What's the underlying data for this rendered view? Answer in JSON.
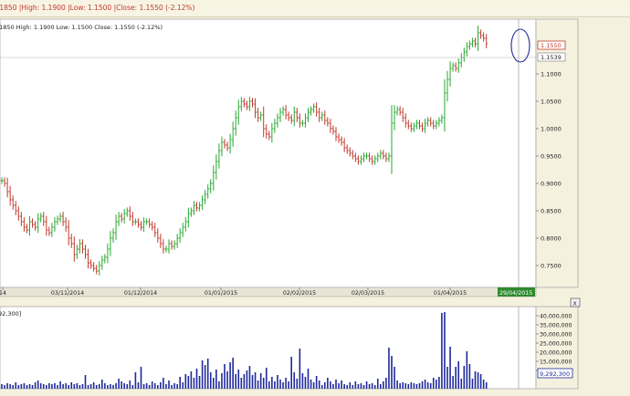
{
  "window": {
    "header_text": ".1850 |High: 1.1900 |Low: 1.1500 |Close: 1.1550 (-2.12%)"
  },
  "price_panel": {
    "legend_text": ".1850   High: 1.1900   Low: 1.1500   Close: 1.1550 (-2.12%)",
    "last_price_label": "1.1550",
    "crosshair_price_label": "1.1539",
    "selected_date_label": "29/04/2015"
  },
  "volume_panel": {
    "legend_text": "92,300]",
    "last_volume_label": "9,292,300",
    "close_label": "x"
  },
  "colors": {
    "up_bar": "#26a92e",
    "down_bar": "#c0392b",
    "volume_bar": "#1f2a9c",
    "last_price_border": "#c0392b",
    "annotation_circle": "#1f2a9c",
    "selected_date_bg": "#2f8a2f"
  },
  "chart_data": {
    "type": "ohlc",
    "ylim": [
      0.71,
      1.2
    ],
    "y_ticks": [
      "1.1000",
      "1.0500",
      "1.0000",
      "0.9500",
      "0.9000",
      "0.8500",
      "0.8000",
      "0.7500"
    ],
    "x_ticks": [
      "14",
      "03/11/2014",
      "01/12/2014",
      "01/01/2015",
      "02/02/2015",
      "02/03/2015",
      "01/04/2015"
    ],
    "closes": [
      0.905,
      0.9,
      0.885,
      0.87,
      0.86,
      0.85,
      0.84,
      0.83,
      0.82,
      0.815,
      0.83,
      0.825,
      0.82,
      0.835,
      0.84,
      0.83,
      0.815,
      0.81,
      0.82,
      0.83,
      0.835,
      0.84,
      0.83,
      0.82,
      0.8,
      0.79,
      0.77,
      0.78,
      0.79,
      0.78,
      0.77,
      0.755,
      0.75,
      0.745,
      0.74,
      0.75,
      0.76,
      0.765,
      0.78,
      0.8,
      0.81,
      0.83,
      0.84,
      0.835,
      0.845,
      0.85,
      0.84,
      0.83,
      0.83,
      0.825,
      0.82,
      0.83,
      0.83,
      0.825,
      0.82,
      0.81,
      0.8,
      0.79,
      0.78,
      0.78,
      0.79,
      0.785,
      0.79,
      0.8,
      0.81,
      0.82,
      0.83,
      0.845,
      0.85,
      0.86,
      0.855,
      0.86,
      0.87,
      0.88,
      0.89,
      0.9,
      0.92,
      0.94,
      0.96,
      0.975,
      0.97,
      0.965,
      0.98,
      1.0,
      1.02,
      1.04,
      1.05,
      1.045,
      1.04,
      1.05,
      1.045,
      1.03,
      1.02,
      1.025,
      1.0,
      0.99,
      0.985,
      1.0,
      1.01,
      1.02,
      1.03,
      1.035,
      1.025,
      1.02,
      1.015,
      1.03,
      1.02,
      1.01,
      1.01,
      1.02,
      1.03,
      1.035,
      1.04,
      1.03,
      1.02,
      1.025,
      1.015,
      1.01,
      1.0,
      0.995,
      0.985,
      0.98,
      0.975,
      0.965,
      0.96,
      0.955,
      0.95,
      0.945,
      0.94,
      0.945,
      0.95,
      0.95,
      0.945,
      0.94,
      0.945,
      0.95,
      0.955,
      0.95,
      0.945,
      0.95,
      1.01,
      1.03,
      1.035,
      1.03,
      1.02,
      1.01,
      1.005,
      1.0,
      1.005,
      1.01,
      1.005,
      1.0,
      1.01,
      1.015,
      1.01,
      1.005,
      1.01,
      1.015,
      1.02,
      1.065,
      1.09,
      1.11,
      1.115,
      1.11,
      1.12,
      1.13,
      1.14,
      1.15,
      1.155,
      1.16,
      1.155,
      1.175,
      1.17,
      1.165,
      1.155
    ],
    "volume_ylim": [
      0,
      45000000
    ],
    "volume_ticks": [
      "40,000,000",
      "35,000,000",
      "30,000,000",
      "25,000,000",
      "20,000,000",
      "15,000,000",
      "10,000,000"
    ],
    "volumes": [
      2500000,
      2000000,
      3000000,
      2500000,
      2000000,
      3500000,
      2000000,
      2500000,
      3000000,
      2000000,
      2500000,
      2000000,
      3500000,
      4500000,
      3000000,
      2500000,
      2000000,
      3000000,
      2500000,
      3000000,
      2000000,
      4000000,
      2500000,
      3000000,
      2000000,
      3500000,
      2500000,
      3000000,
      2000000,
      2500000,
      7500000,
      2000000,
      2500000,
      3500000,
      2000000,
      2500000,
      5000000,
      3000000,
      2000000,
      2500000,
      2000000,
      3000000,
      5500000,
      4000000,
      3000000,
      2500000,
      4500000,
      2000000,
      9000000,
      3500000,
      12000000,
      2500000,
      3000000,
      2000000,
      4000000,
      3000000,
      2000000,
      3500000,
      6000000,
      2500000,
      4500000,
      2000000,
      3000000,
      2500000,
      6500000,
      3500000,
      8000000,
      7000000,
      9500000,
      6000000,
      11000000,
      7000000,
      15500000,
      13000000,
      16500000,
      9000000,
      6000000,
      10500000,
      4000000,
      8500000,
      13500000,
      9500000,
      14500000,
      17000000,
      8000000,
      10500000,
      6000000,
      8000000,
      10000000,
      12500000,
      7500000,
      9000000,
      4500000,
      8500000,
      6000000,
      11500000,
      4000000,
      6500000,
      4000000,
      7500000,
      5000000,
      3500000,
      6000000,
      4000000,
      17500000,
      9000000,
      5500000,
      22000000,
      8500000,
      6500000,
      11000000,
      5000000,
      3500000,
      7000000,
      4500000,
      2000000,
      3500000,
      6000000,
      4000000,
      2500000,
      5000000,
      3000000,
      4500000,
      2500000,
      2000000,
      3500000,
      2000000,
      4000000,
      2500000,
      3000000,
      2000000,
      4000000,
      2500000,
      3000000,
      2000000,
      5500000,
      2500000,
      4000000,
      6000000,
      22500000,
      18000000,
      12000000,
      4500000,
      3000000,
      3500000,
      3000000,
      2500000,
      3500000,
      3000000,
      2500000,
      3000000,
      4000000,
      5000000,
      3500000,
      3000000,
      6000000,
      5000000,
      6500000,
      41500000,
      42000000,
      12000000,
      23000000,
      7000000,
      12000000,
      15000000,
      5500000,
      12500000,
      20500000,
      13500000,
      5500000,
      9500000,
      9000000,
      8000000,
      5000000,
      3500000
    ]
  }
}
